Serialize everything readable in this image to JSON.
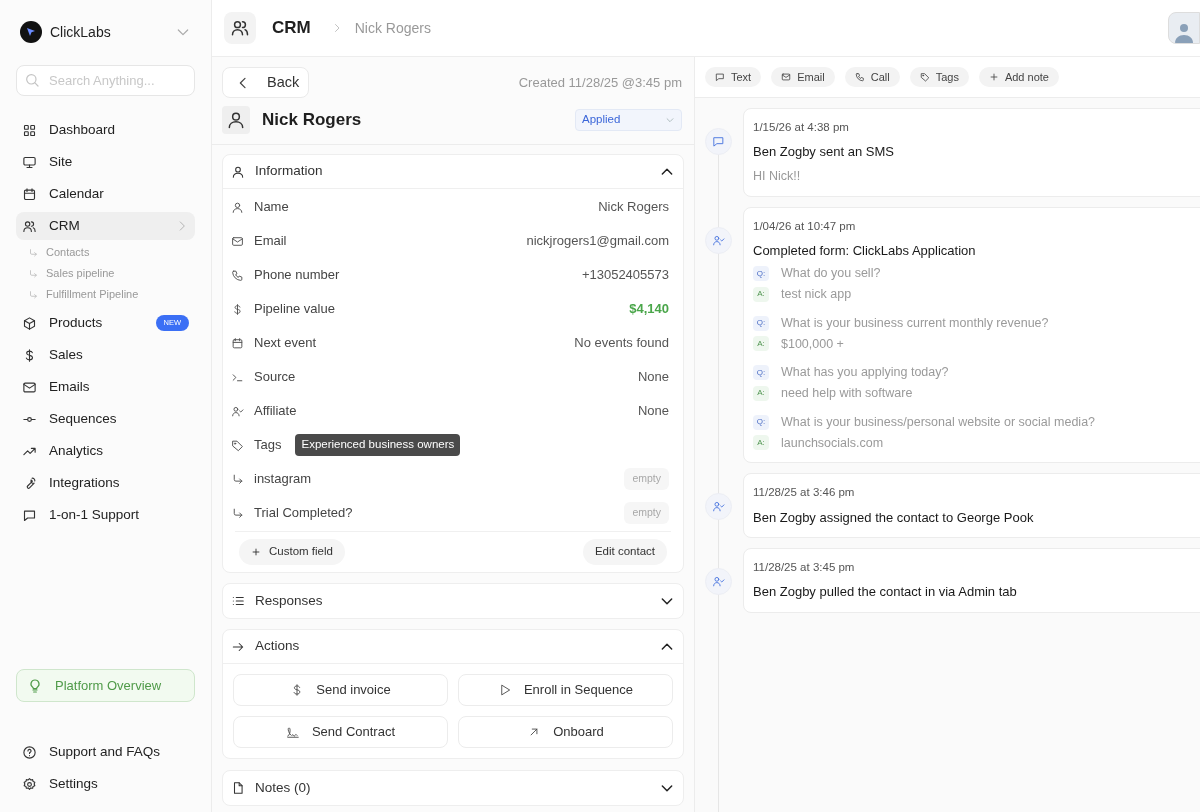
{
  "sidebar": {
    "workspace": "ClickLabs",
    "search": {
      "placeholder": "Search Anything..."
    },
    "items": [
      {
        "label": "Dashboard",
        "selected": false
      },
      {
        "label": "Site",
        "selected": false
      },
      {
        "label": "Calendar",
        "selected": false
      },
      {
        "label": "CRM",
        "selected": true,
        "expanded": true,
        "children": [
          {
            "label": "Contacts"
          },
          {
            "label": "Sales pipeline"
          },
          {
            "label": "Fulfillment Pipeline"
          }
        ]
      },
      {
        "label": "Products",
        "selected": false,
        "badge": "NEW"
      },
      {
        "label": "Sales",
        "selected": false
      },
      {
        "label": "Emails",
        "selected": false
      },
      {
        "label": "Sequences",
        "selected": false
      },
      {
        "label": "Analytics",
        "selected": false
      },
      {
        "label": "Integrations",
        "selected": false
      },
      {
        "label": "1-on-1 Support",
        "selected": false
      }
    ],
    "promo": "Platform Overview",
    "footer": [
      "Support and FAQs",
      "Settings"
    ]
  },
  "header": {
    "section": "CRM",
    "breadcrumb": "Nick Rogers"
  },
  "contact": {
    "back": "Back",
    "created": "Created 11/28/25 @3:45 pm",
    "name": "Nick Rogers",
    "status": "Applied",
    "information": {
      "title": "Information",
      "expanded": true,
      "rows": [
        {
          "label": "Name",
          "value": "Nick Rogers",
          "kind": "text"
        },
        {
          "label": "Email",
          "value": "nickjrogers1@gmail.com",
          "kind": "text"
        },
        {
          "label": "Phone number",
          "value": "+13052405573",
          "kind": "text"
        },
        {
          "label": "Pipeline value",
          "value": "$4,140",
          "kind": "money"
        },
        {
          "label": "Next event",
          "value": "No events found",
          "kind": "text"
        },
        {
          "label": "Source",
          "value": "None",
          "kind": "text"
        },
        {
          "label": "Affiliate",
          "value": "None",
          "kind": "text"
        },
        {
          "label": "Tags",
          "value": "Experienced business owners",
          "kind": "tag"
        },
        {
          "label": "instagram",
          "value": "empty",
          "kind": "custom"
        },
        {
          "label": "Trial Completed?",
          "value": "empty",
          "kind": "custom"
        }
      ],
      "buttons": [
        "Custom field",
        "Edit contact"
      ]
    },
    "responses": {
      "title": "Responses",
      "expanded": false
    },
    "actions": {
      "title": "Actions",
      "expanded": true,
      "buttons": [
        "Send invoice",
        "Enroll in Sequence",
        "Send Contract",
        "Onboard"
      ]
    },
    "notes": {
      "title": "Notes (0)",
      "expanded": false
    }
  },
  "activity": {
    "toolbar": [
      "Text",
      "Email",
      "Call",
      "Tags",
      "Add note"
    ],
    "entries": [
      {
        "kind": "sms",
        "time": "1/15/26 at 4:38 pm",
        "title": "Ben Zogby sent an SMS",
        "body": "HI Nick!!"
      },
      {
        "kind": "form",
        "time": "1/04/26 at 10:47 pm",
        "title": "Completed form: ClickLabs Application",
        "qa": [
          {
            "q_mark": "Q:",
            "q": "What do you sell?",
            "a_mark": "A:",
            "a": "test nick app"
          },
          {
            "q_mark": "Q:",
            "q": "What is your business current monthly revenue?",
            "a_mark": "A:",
            "a": "$100,000 +"
          },
          {
            "q_mark": "Q:",
            "q": "What has you applying today?",
            "a_mark": "A:",
            "a": "need help with software"
          },
          {
            "q_mark": "Q:",
            "q": "What is your business/personal website or social media?",
            "a_mark": "A:",
            "a": "launchsocials.com"
          }
        ]
      },
      {
        "kind": "event",
        "time": "11/28/25 at 3:46 pm",
        "title": "Ben Zogby assigned the contact to George Pook"
      },
      {
        "kind": "event",
        "time": "11/28/25 at 3:45 pm",
        "title": "Ben Zogby pulled the contact in via Admin tab"
      }
    ]
  }
}
